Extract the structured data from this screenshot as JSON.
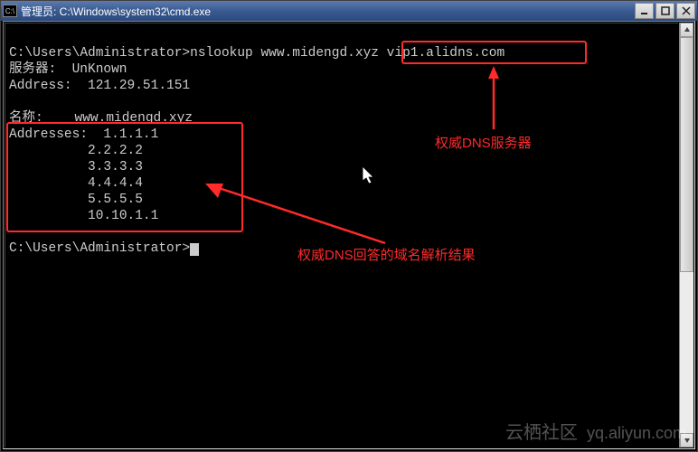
{
  "titlebar": {
    "icon_text": "C:\\",
    "title": "管理员: C:\\Windows\\system32\\cmd.exe"
  },
  "console": {
    "prompt_line": "C:\\Users\\Administrator>nslookup www.midengd.xyz vip1.alidns.com",
    "server_label": "服务器:  UnKnown",
    "address_label": "Address:  121.29.51.151",
    "name_label": "名称:    www.midengd.xyz",
    "addresses_header": "Addresses:  1.1.1.1",
    "addr2": "          2.2.2.2",
    "addr3": "          3.3.3.3",
    "addr4": "          4.4.4.4",
    "addr5": "          5.5.5.5",
    "addr6": "          10.10.1.1",
    "prompt2": "C:\\Users\\Administrator>"
  },
  "annotations": {
    "dns_server_label": "权威DNS服务器",
    "result_label": "权威DNS回答的域名解析结果"
  },
  "watermark": {
    "cn": "云栖社区",
    "en": "yq.aliyun.com"
  }
}
